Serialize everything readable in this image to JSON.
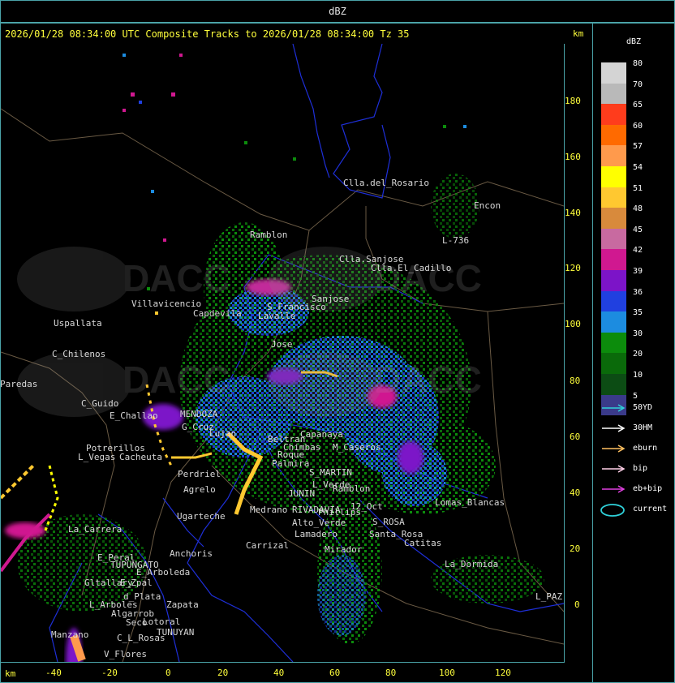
{
  "header": {
    "title": "dBZ"
  },
  "map": {
    "subtitle": "2026/01/28 08:34:00 UTC Composite Tracks to 2026/01/28 08:34:00 Tz 35",
    "unit_top": "km",
    "unit_bottom": "km",
    "y_ticks": [
      "180",
      "160",
      "140",
      "120",
      "100",
      "80",
      "60",
      "40",
      "20",
      "0"
    ],
    "x_ticks": [
      "-40",
      "-20",
      "0",
      "20",
      "40",
      "60",
      "80",
      "100",
      "120"
    ],
    "places": [
      "Clla.del_Rosario",
      "Encon",
      "Ramblon",
      "Clla.Sanjose",
      "Clla.El_Cadillo",
      "L-736",
      "Villavicencio",
      "Capdevila",
      "S_Francisco",
      "Lavalle",
      "Uspallata",
      "C_Chilenos",
      "Paredas",
      "C_Guido",
      "E_Challao",
      "MENDOZA",
      "G_Cruz",
      "Lujan",
      "Potrerillos",
      "L_Vegas",
      "Cacheuta",
      "Perdriel",
      "Agrelo",
      "Ugarteche",
      "La_Carrera",
      "E_Peral",
      "TUPUNGATO",
      "Anchoris",
      "Carrizal",
      "E_Arboleda",
      "Gltallary",
      "E_Zpal",
      "d_Plata",
      "L_Arboles",
      "Algarrob",
      "Zapata",
      "Seco",
      "Lotoral",
      "TUNUYAN",
      "Manzano",
      "C_L_Rosas",
      "V_Flores",
      "Chimbas",
      "Capanaya",
      "M_Caseros",
      "S_MARTIN",
      "L_Verde",
      "Ramblon",
      "Phillips",
      "JUNIN",
      "RIVADAVIA",
      "Alto_Verde",
      "Lamadero",
      "Medrano",
      "Mirador",
      "12_Oct",
      "S_ROSA",
      "Lomas_Blancas",
      "Catitas",
      "La_Dormida",
      "L_PAZ",
      "Santa_Rosa",
      "Sanjose",
      "Jose",
      "Roque",
      "Palmira",
      "Beltran"
    ]
  },
  "legend": {
    "title": "dBZ",
    "scale": [
      {
        "value": "80",
        "color": "#d4d4d4"
      },
      {
        "value": "70",
        "color": "#b9b9b9"
      },
      {
        "value": "65",
        "color": "#ff3c1c"
      },
      {
        "value": "60",
        "color": "#ff6a00"
      },
      {
        "value": "57",
        "color": "#ff9a4c"
      },
      {
        "value": "54",
        "color": "#ffff00"
      },
      {
        "value": "51",
        "color": "#ffc830"
      },
      {
        "value": "48",
        "color": "#d88a3c"
      },
      {
        "value": "45",
        "color": "#c86aa0"
      },
      {
        "value": "42",
        "color": "#d01890"
      },
      {
        "value": "39",
        "color": "#7c14c8"
      },
      {
        "value": "36",
        "color": "#2040e0"
      },
      {
        "value": "35",
        "color": "#1c8ce0"
      },
      {
        "value": "30",
        "color": "#0c8c0c"
      },
      {
        "value": "20",
        "color": "#0a6a0a"
      },
      {
        "value": "10",
        "color": "#0c4c14"
      },
      {
        "value": "5",
        "color": "#3a3a8a"
      }
    ],
    "tracks": [
      {
        "label": "50YD",
        "color": "#2fd0d8"
      },
      {
        "label": "30HM",
        "color": "#ffffff"
      },
      {
        "label": "eburn",
        "color": "#ffc060"
      },
      {
        "label": "bip",
        "color": "#ffd0e8"
      },
      {
        "label": "eb+bip",
        "color": "#e040e0"
      },
      {
        "label": "current",
        "color": "#2fd0d8"
      }
    ]
  }
}
